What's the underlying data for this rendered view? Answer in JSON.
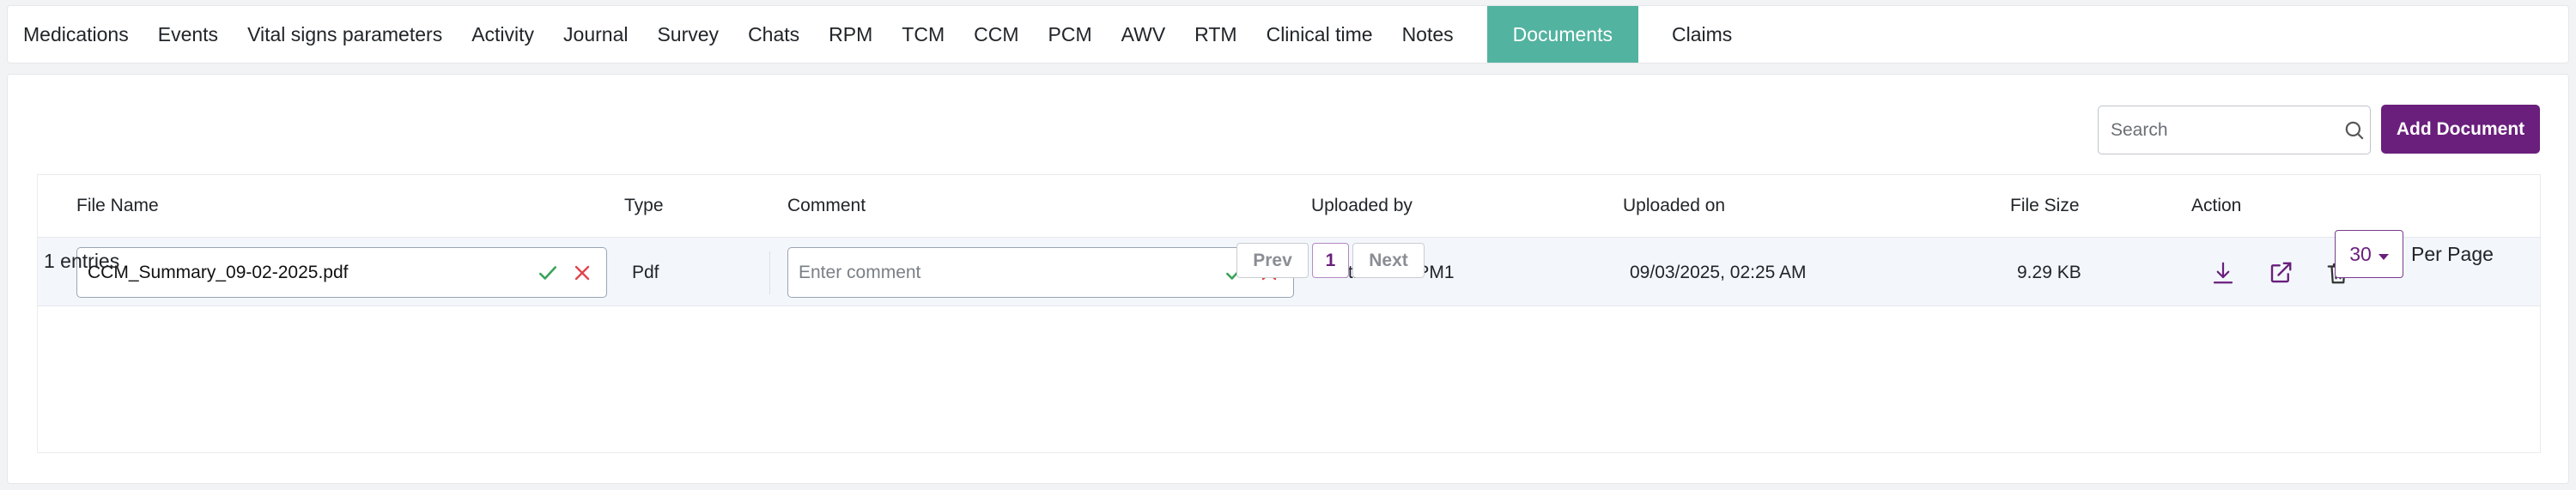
{
  "tabs": [
    {
      "label": "Medications"
    },
    {
      "label": "Events"
    },
    {
      "label": "Vital signs parameters"
    },
    {
      "label": "Activity"
    },
    {
      "label": "Journal"
    },
    {
      "label": "Survey"
    },
    {
      "label": "Chats"
    },
    {
      "label": "RPM"
    },
    {
      "label": "TCM"
    },
    {
      "label": "CCM"
    },
    {
      "label": "PCM"
    },
    {
      "label": "AWV"
    },
    {
      "label": "RTM"
    },
    {
      "label": "Clinical time"
    },
    {
      "label": "Notes"
    },
    {
      "label": "Documents",
      "active": true
    },
    {
      "label": "Claims"
    }
  ],
  "toolbar": {
    "search_placeholder": "Search",
    "add_label": "Add Document"
  },
  "table": {
    "headers": [
      "File Name",
      "Type",
      "Comment",
      "Uploaded by",
      "Uploaded on",
      "File Size",
      "Action"
    ],
    "rows": [
      {
        "file_name": "CCM_Summary_09-02-2025.pdf",
        "type": "Pdf",
        "comment_placeholder": "Enter comment",
        "uploaded_by": "Multi center PM1",
        "uploaded_on": "09/03/2025, 02:25 AM",
        "file_size": "9.29 KB"
      }
    ]
  },
  "footer": {
    "entries": "1 entries",
    "prev": "Prev",
    "page": "1",
    "next": "Next",
    "per_page_value": "30",
    "per_page_label": "Per Page"
  },
  "colors": {
    "active_tab": "#52b3a0",
    "primary": "#6a1f7c",
    "confirm": "#3aa35a",
    "cancel": "#e0474c"
  },
  "icons": [
    "search-icon",
    "check-icon",
    "close-icon",
    "download-icon",
    "open-external-icon",
    "trash-icon",
    "caret-down-icon"
  ]
}
